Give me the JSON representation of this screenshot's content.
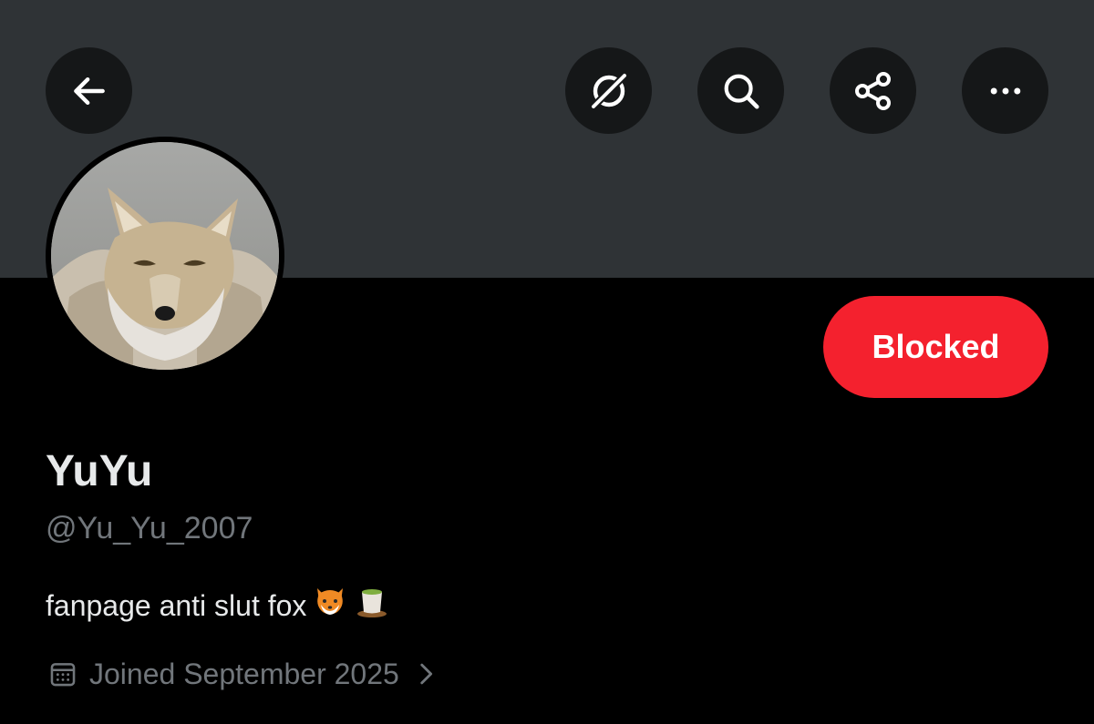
{
  "header": {
    "back_icon": "arrow-left-icon",
    "grok_icon": "grok-icon",
    "search_icon": "search-icon",
    "share_icon": "share-icon",
    "more_icon": "more-horizontal-icon"
  },
  "profile": {
    "display_name": "YuYu",
    "handle": "@Yu_Yu_2007",
    "bio": "fanpage anti slut fox",
    "bio_emojis": [
      "fox-face-emoji",
      "teacup-emoji"
    ],
    "joined": "Joined September 2025",
    "avatar": "fox-avatar"
  },
  "actions": {
    "blocked_label": "Blocked"
  },
  "colors": {
    "banner": "#2f3336",
    "background": "#000000",
    "button_bg": "#151718",
    "blocked": "#f4212e",
    "secondary_text": "#71767b",
    "primary_text": "#e7e9ea"
  }
}
